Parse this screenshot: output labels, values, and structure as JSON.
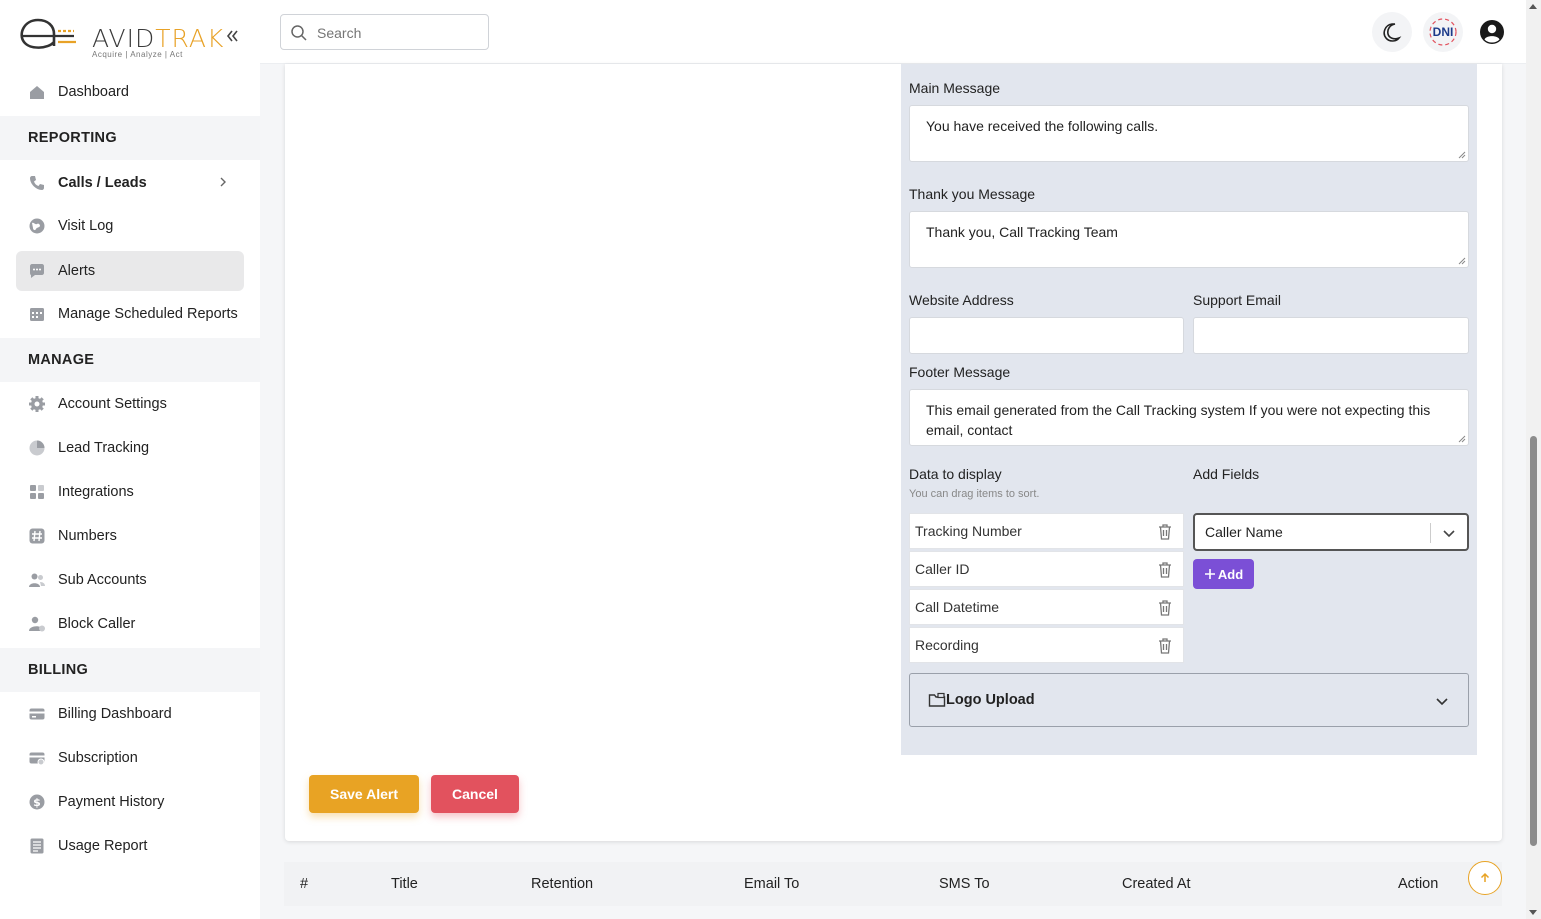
{
  "brand": {
    "name_part1": "AVID",
    "name_part2": "TRAK",
    "tagline": "Acquire  |  Analyze  |  Act",
    "accent_color": "#e8a227"
  },
  "sidebar": {
    "collapse_icon": "chevrons-left-icon",
    "items": [
      {
        "label": "Dashboard",
        "icon": "home-icon"
      },
      {
        "label": "Calls / Leads",
        "icon": "phone-icon"
      },
      {
        "label": "Visit Log",
        "icon": "globe-icon"
      },
      {
        "label": "Alerts",
        "icon": "chat-bubble-icon"
      },
      {
        "label": "Manage Scheduled Reports",
        "icon": "calendar-icon"
      },
      {
        "label": "Account Settings",
        "icon": "gear-icon"
      },
      {
        "label": "Lead Tracking",
        "icon": "pie-chart-icon"
      },
      {
        "label": "Integrations",
        "icon": "grid-icon"
      },
      {
        "label": "Numbers",
        "icon": "hash-icon"
      },
      {
        "label": "Sub Accounts",
        "icon": "users-icon"
      },
      {
        "label": "Block Caller",
        "icon": "user-block-icon"
      },
      {
        "label": "Billing Dashboard",
        "icon": "credit-card-icon"
      },
      {
        "label": "Subscription",
        "icon": "card-settings-icon"
      },
      {
        "label": "Payment History",
        "icon": "dollar-icon"
      },
      {
        "label": "Usage Report",
        "icon": "report-icon"
      }
    ],
    "sections": {
      "reporting": "REPORTING",
      "manage": "MANAGE",
      "billing": "BILLING"
    }
  },
  "topbar": {
    "search_placeholder": "Search",
    "dni_label": "DNI"
  },
  "form": {
    "main_message_label": "Main Message",
    "main_message_value": "You have received the following calls.",
    "thank_you_label": "Thank you Message",
    "thank_you_value": "Thank you, Call Tracking Team",
    "website_label": "Website Address",
    "website_value": "",
    "support_email_label": "Support Email",
    "support_email_value": "",
    "footer_label": "Footer Message",
    "footer_value": "This email generated from the Call Tracking system If you were not expecting this email, contact",
    "data_display_label": "Data to display",
    "data_display_hint": "You can drag items to sort.",
    "data_items": [
      "Tracking Number",
      "Caller ID",
      "Call Datetime",
      "Recording"
    ],
    "add_fields_label": "Add Fields",
    "add_fields_selected": "Caller Name",
    "add_button": "Add",
    "logo_upload_label": "Logo Upload",
    "save_button": "Save Alert",
    "cancel_button": "Cancel"
  },
  "table": {
    "headers": [
      "#",
      "Title",
      "Retention",
      "Email To",
      "SMS To",
      "Created At",
      "Action"
    ]
  }
}
